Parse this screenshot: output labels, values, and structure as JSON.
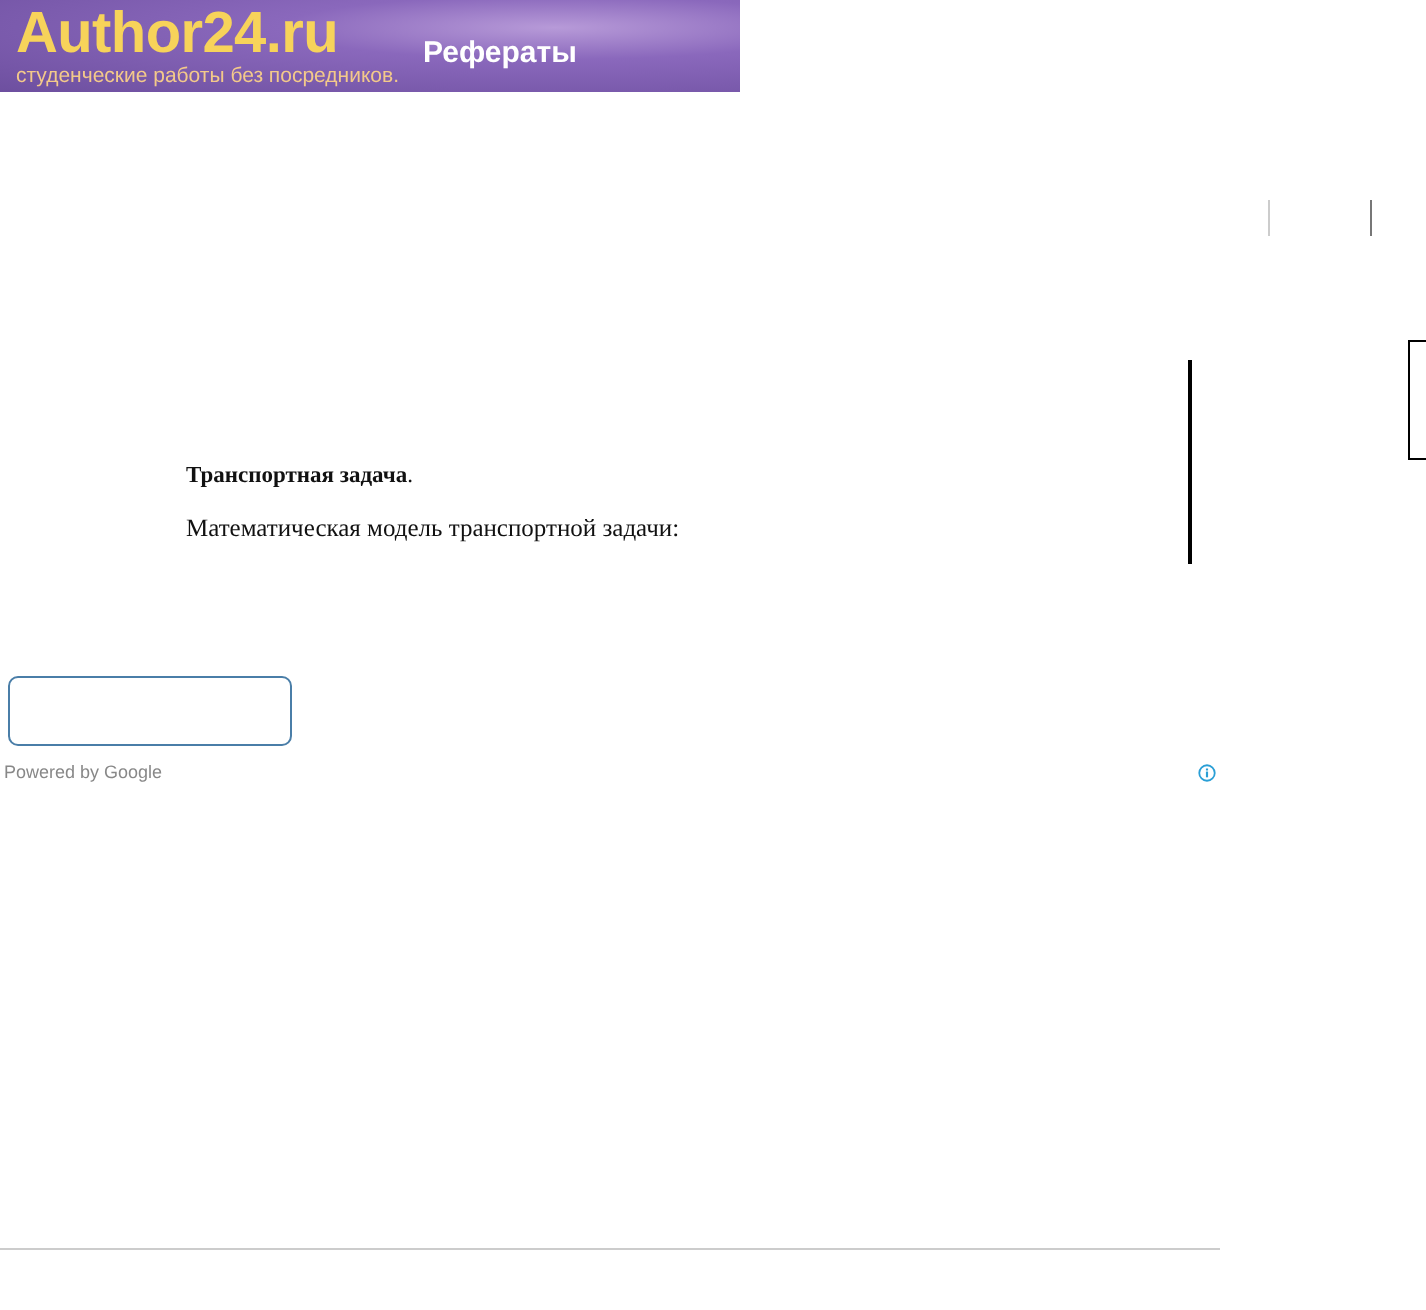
{
  "banner": {
    "logo": "Author24.ru",
    "tagline": "студенческие работы без посредников.",
    "section": "Рефераты"
  },
  "article": {
    "title": "**Транспортная задача**.",
    "paragraph": "Математическая модель транспортной задачи:"
  },
  "search_branding": "Powered by Google"
}
